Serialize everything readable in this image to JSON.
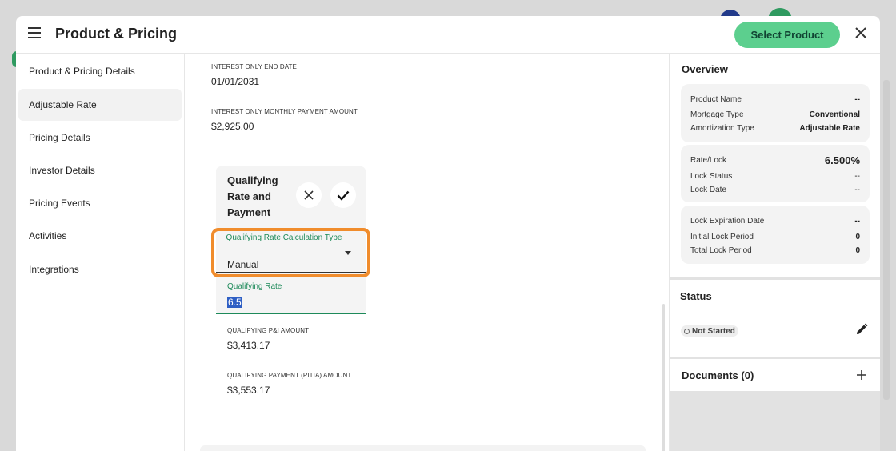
{
  "header": {
    "title": "Product & Pricing",
    "select_product_label": "Select Product"
  },
  "nav": {
    "items": [
      {
        "label": "Product & Pricing Details",
        "active": false
      },
      {
        "label": "Adjustable Rate",
        "active": true
      },
      {
        "label": "Pricing Details",
        "active": false
      },
      {
        "label": "Investor Details",
        "active": false
      },
      {
        "label": "Pricing Events",
        "active": false
      },
      {
        "label": "Activities",
        "active": false
      },
      {
        "label": "Integrations",
        "active": false
      }
    ]
  },
  "main": {
    "interest_only_end_date_label": "INTEREST ONLY END DATE",
    "interest_only_end_date_value": "01/01/2031",
    "interest_only_payment_label": "INTEREST ONLY MONTHLY PAYMENT AMOUNT",
    "interest_only_payment_value": "$2,925.00",
    "qualifying": {
      "title": "Qualifying Rate and Payment",
      "calc_type_label": "Qualifying Rate Calculation Type",
      "calc_type_value": "Manual",
      "rate_label": "Qualifying Rate",
      "rate_value": "6.5",
      "pi_label": "QUALIFYING P&I AMOUNT",
      "pi_value": "$3,413.17",
      "pitia_label": "QUALIFYING PAYMENT (PITIA) AMOUNT",
      "pitia_value": "$3,553.17"
    }
  },
  "overview": {
    "heading": "Overview",
    "product_name_label": "Product Name",
    "product_name_value": "--",
    "mortgage_type_label": "Mortgage Type",
    "mortgage_type_value": "Conventional",
    "amortization_type_label": "Amortization Type",
    "amortization_type_value": "Adjustable Rate",
    "rate_lock_label": "Rate/Lock",
    "rate_lock_value": "6.500%",
    "lock_status_label": "Lock Status",
    "lock_status_value": "--",
    "lock_date_label": "Lock Date",
    "lock_date_value": "--",
    "lock_expiration_label": "Lock Expiration Date",
    "lock_expiration_value": "--",
    "initial_lock_period_label": "Initial Lock Period",
    "initial_lock_period_value": "0",
    "total_lock_period_label": "Total Lock Period",
    "total_lock_period_value": "0"
  },
  "status": {
    "heading": "Status",
    "badge": "Not Started"
  },
  "documents": {
    "heading": "Documents (0)"
  },
  "colors": {
    "accent_green": "#5ccf8e",
    "label_green": "#1e8a5a",
    "highlight_orange": "#f08c2c",
    "selection_blue": "#2f5fc4"
  }
}
